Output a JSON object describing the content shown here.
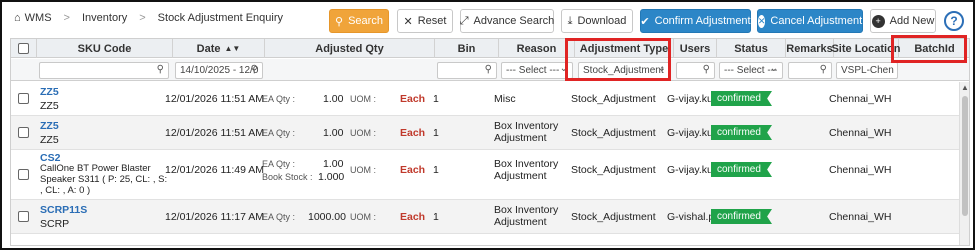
{
  "breadcrumb": {
    "home": "WMS",
    "section": "Inventory",
    "page": "Stock Adjustment Enquiry"
  },
  "toolbar": {
    "search": "Search",
    "reset": "Reset",
    "advance_search": "Advance Search",
    "download": "Download",
    "confirm": "Confirm Adjustment",
    "cancel": "Cancel Adjustment",
    "add_new": "Add New",
    "help": "?"
  },
  "columns": {
    "sku_code": "SKU Code",
    "date": "Date",
    "adjusted_qty": "Adjusted Qty",
    "bin": "Bin",
    "reason": "Reason",
    "adjustment_type": "Adjustment Type",
    "users": "Users",
    "status": "Status",
    "remarks": "Remarks",
    "site_location": "Site Location",
    "batch_id": "BatchId"
  },
  "filters": {
    "date": "14/10/2025 - 12/0",
    "reason": "--- Select ---",
    "adjustment_type": "Stock_Adjustment",
    "status": "--- Select ---",
    "site_location": "VSPL-Chen"
  },
  "rows": [
    {
      "sku": "ZZ5",
      "desc": "ZZ5",
      "date": "12/01/2026 11:51 AM",
      "ea_label": "EA Qty :",
      "ea_qty": "1.00",
      "uom_label": "UOM :",
      "uom": "Each",
      "bin": "1",
      "reason": "Misc",
      "adj_type": "Stock_Adjustment",
      "user": "G-vijay.ku",
      "status": "confirmed",
      "site": "Chennai_WH"
    },
    {
      "sku": "ZZ5",
      "desc": "ZZ5",
      "date": "12/01/2026 11:51 AM",
      "ea_label": "EA Qty :",
      "ea_qty": "1.00",
      "uom_label": "UOM :",
      "uom": "Each",
      "bin": "1",
      "reason": "Box Inventory Adjustment",
      "adj_type": "Stock_Adjustment",
      "user": "G-vijay.ku",
      "status": "confirmed",
      "site": "Chennai_WH"
    },
    {
      "sku": "CS2",
      "desc_l1": "CallOne BT Power Blaster",
      "desc_l2": "Speaker S311 ( P: 25, CL: , S:",
      "desc_l3": ", CL: , A: 0 )",
      "date": "12/01/2026 11:49 AM",
      "ea_label": "EA Qty :",
      "ea_qty": "1.00",
      "book_label": "Book Stock :",
      "book_qty": "1.000",
      "uom_label": "UOM :",
      "uom": "Each",
      "bin": "1",
      "reason": "Box Inventory Adjustment",
      "adj_type": "Stock_Adjustment",
      "user": "G-vijay.ku",
      "status": "confirmed",
      "site": "Chennai_WH"
    },
    {
      "sku": "SCRP11S",
      "desc": "SCRP",
      "date": "12/01/2026 11:17 AM",
      "ea_label": "EA Qty :",
      "ea_qty": "1000.00",
      "uom_label": "UOM :",
      "uom": "Each",
      "bin": "1",
      "reason": "Box Inventory Adjustment",
      "adj_type": "Stock_Adjustment",
      "user": "G-vishal.p",
      "status": "confirmed",
      "site": "Chennai_WH"
    }
  ],
  "colors": {
    "search_btn": "#f0a43a",
    "primary_btn": "#2c86c7",
    "status_badge": "#20a34a",
    "sku_link": "#2a6db5",
    "uom_text": "#c0392b",
    "highlight": "#e02424"
  }
}
